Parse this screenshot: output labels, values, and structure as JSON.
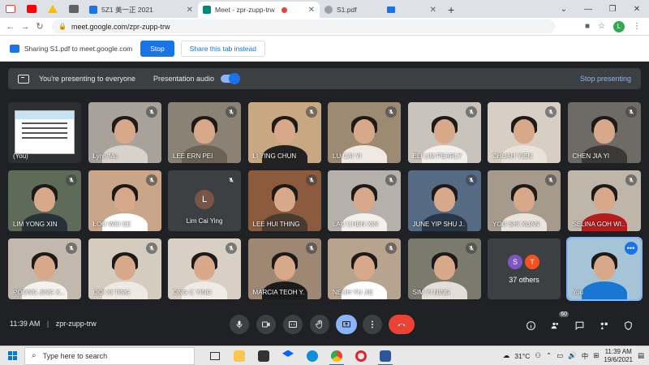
{
  "browser": {
    "tabs": [
      {
        "title": "5Z1 美一正 2021",
        "active": false
      },
      {
        "title": "Meet - zpr-zupp-trw",
        "active": true
      },
      {
        "title": "S1.pdf",
        "active": false
      }
    ],
    "new_tab": "+",
    "url": "meet.google.com/zpr-zupp-trw",
    "profile_initial": "L"
  },
  "sharebar": {
    "text": "Sharing S1.pdf to meet.google.com",
    "stop_label": "Stop",
    "share_tab_label": "Share this tab instead"
  },
  "presenting": {
    "text": "You're presenting to everyone",
    "audio_label": "Presentation audio",
    "audio_on": true,
    "stop_label": "Stop presenting"
  },
  "participants": [
    {
      "name": "(You)",
      "type": "presentation"
    },
    {
      "name": "Lynn Mu",
      "type": "video",
      "bg": "#a9a29b",
      "shirt": "#d9d2cc"
    },
    {
      "name": "LEE ERN PEI",
      "type": "video",
      "bg": "#8a8275",
      "shirt": "#6b6256"
    },
    {
      "name": "LI YING CHUN",
      "type": "video",
      "bg": "#c7a883",
      "shirt": "#222222"
    },
    {
      "name": "LU CAI YI",
      "type": "video",
      "bg": "#9c8a73",
      "shirt": "#efe9e2"
    },
    {
      "name": "ELI LIM PEARLY",
      "type": "video",
      "bg": "#c9c3bb",
      "shirt": "#f2eeea"
    },
    {
      "name": "CHUAH YIEN",
      "type": "video",
      "bg": "#d7cfc4",
      "shirt": "#e8e2d8"
    },
    {
      "name": "CHEN JIA YI",
      "type": "video",
      "bg": "#6e6a65",
      "shirt": "#3b3936"
    },
    {
      "name": "LIM YONG XIN",
      "type": "video",
      "bg": "#5f6b59",
      "shirt": "#263238"
    },
    {
      "name": "LOO WEI EE",
      "type": "video",
      "bg": "#c9a58a",
      "shirt": "#ffffff"
    },
    {
      "name": "Lim Cai Ying",
      "type": "avatar",
      "initial": "L"
    },
    {
      "name": "LEE HUI THING",
      "type": "video",
      "bg": "#8c5a3c",
      "shirt": "#4a3b30"
    },
    {
      "name": "LAU CHEN XIN",
      "type": "video",
      "bg": "#b6b0aa",
      "shirt": "#f3f0ec"
    },
    {
      "name": "JUNE YIP SHU J...",
      "type": "video",
      "bg": "#556b84",
      "shirt": "#283646"
    },
    {
      "name": "YOO SHI XUAN",
      "type": "video",
      "bg": "#a59a8c",
      "shirt": "#e9e3dc"
    },
    {
      "name": "SELINA GOH WI...",
      "type": "video",
      "bg": "#bfb6aa",
      "shirt": "#b71c1c"
    },
    {
      "name": "POONG JING X...",
      "type": "video",
      "bg": "#c2b9ae",
      "shirt": "#f5f2ee"
    },
    {
      "name": "OOI XI TING",
      "type": "video",
      "bg": "#d5ccc0",
      "shirt": "#efe9e1"
    },
    {
      "name": "ONG C YING",
      "type": "video",
      "bg": "#d8d0c5",
      "shirt": "#f0ebe5"
    },
    {
      "name": "MARCIA TEOH Y...",
      "type": "video",
      "bg": "#9e8874",
      "shirt": "#1b1b1b"
    },
    {
      "name": "NEOH YU JIE",
      "type": "video",
      "bg": "#b8a48e",
      "shirt": "#ffffff"
    },
    {
      "name": "SIM YI NING",
      "type": "video",
      "bg": "#7a7b6d",
      "shirt": "#e3ded7"
    },
    {
      "name": "37 others",
      "type": "others",
      "initials": [
        "S",
        "T"
      ],
      "colors": [
        "#7e57c2",
        "#f4511e"
      ]
    },
    {
      "name": "You",
      "type": "self",
      "bg": "#a5c4d6",
      "shirt": "#1976d2"
    }
  ],
  "controls": {
    "time": "11:39 AM",
    "meeting_code": "zpr-zupp-trw",
    "people_count": "60"
  },
  "taskbar": {
    "search_placeholder": "Type here to search",
    "temperature": "31°C",
    "language": "中",
    "time": "11:39 AM",
    "date": "19/6/2021"
  },
  "colors": {
    "accent": "#1a73e8",
    "meet_bg": "#202124",
    "tile_bg": "#3c4043",
    "hangup": "#ea4335"
  }
}
